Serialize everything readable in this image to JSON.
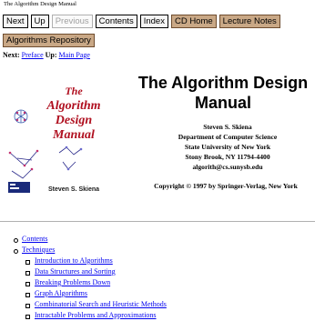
{
  "document": {
    "title": "The Algorithm Design Manual"
  },
  "nav": {
    "row1": [
      {
        "label": "Next",
        "name": "next-button",
        "style": "normal"
      },
      {
        "label": "Up",
        "name": "up-button",
        "style": "normal"
      },
      {
        "label": "Previous",
        "name": "previous-button",
        "style": "disabled"
      },
      {
        "label": "Contents",
        "name": "contents-button",
        "style": "normal"
      },
      {
        "label": "Index",
        "name": "index-button",
        "style": "normal"
      },
      {
        "label": "CD Home",
        "name": "cd-home-button",
        "style": "brown"
      },
      {
        "label": "Lecture Notes",
        "name": "lecture-notes-button",
        "style": "brown"
      }
    ],
    "row2": [
      {
        "label": "Algorithms Repository",
        "name": "algorithms-repository-button",
        "style": "brown"
      }
    ]
  },
  "nextline": {
    "next_prefix": "Next:",
    "next_link": "Preface",
    "up_prefix": "Up:",
    "up_link": "Main Page"
  },
  "cover": {
    "title_lines": [
      "The",
      "Algorithm",
      "Design",
      "Manual"
    ],
    "author": "Steven S. Skiena",
    "colors": {
      "title": "#b01020",
      "background": "#ffffff"
    }
  },
  "book": {
    "title": "The Algorithm Design Manual",
    "author_lines": [
      "Steven S. Skiena",
      "Department of Computer Science",
      "State University of New York",
      "Stony Brook, NY 11794-4400",
      "algorith@cs.sunysb.edu"
    ],
    "copyright": "Copyright © 1997 by Springer-Verlag, New York"
  },
  "toc": {
    "items": [
      {
        "label": "Contents",
        "children": []
      },
      {
        "label": "Techniques",
        "children": [
          "Introduction to Algorithms",
          "Data Structures and Sorting",
          "Breaking Problems Down",
          "Graph Algorithms",
          "Combinatorial Search and Heuristic Methods",
          "Intractable Problems and Approximations"
        ]
      }
    ]
  }
}
